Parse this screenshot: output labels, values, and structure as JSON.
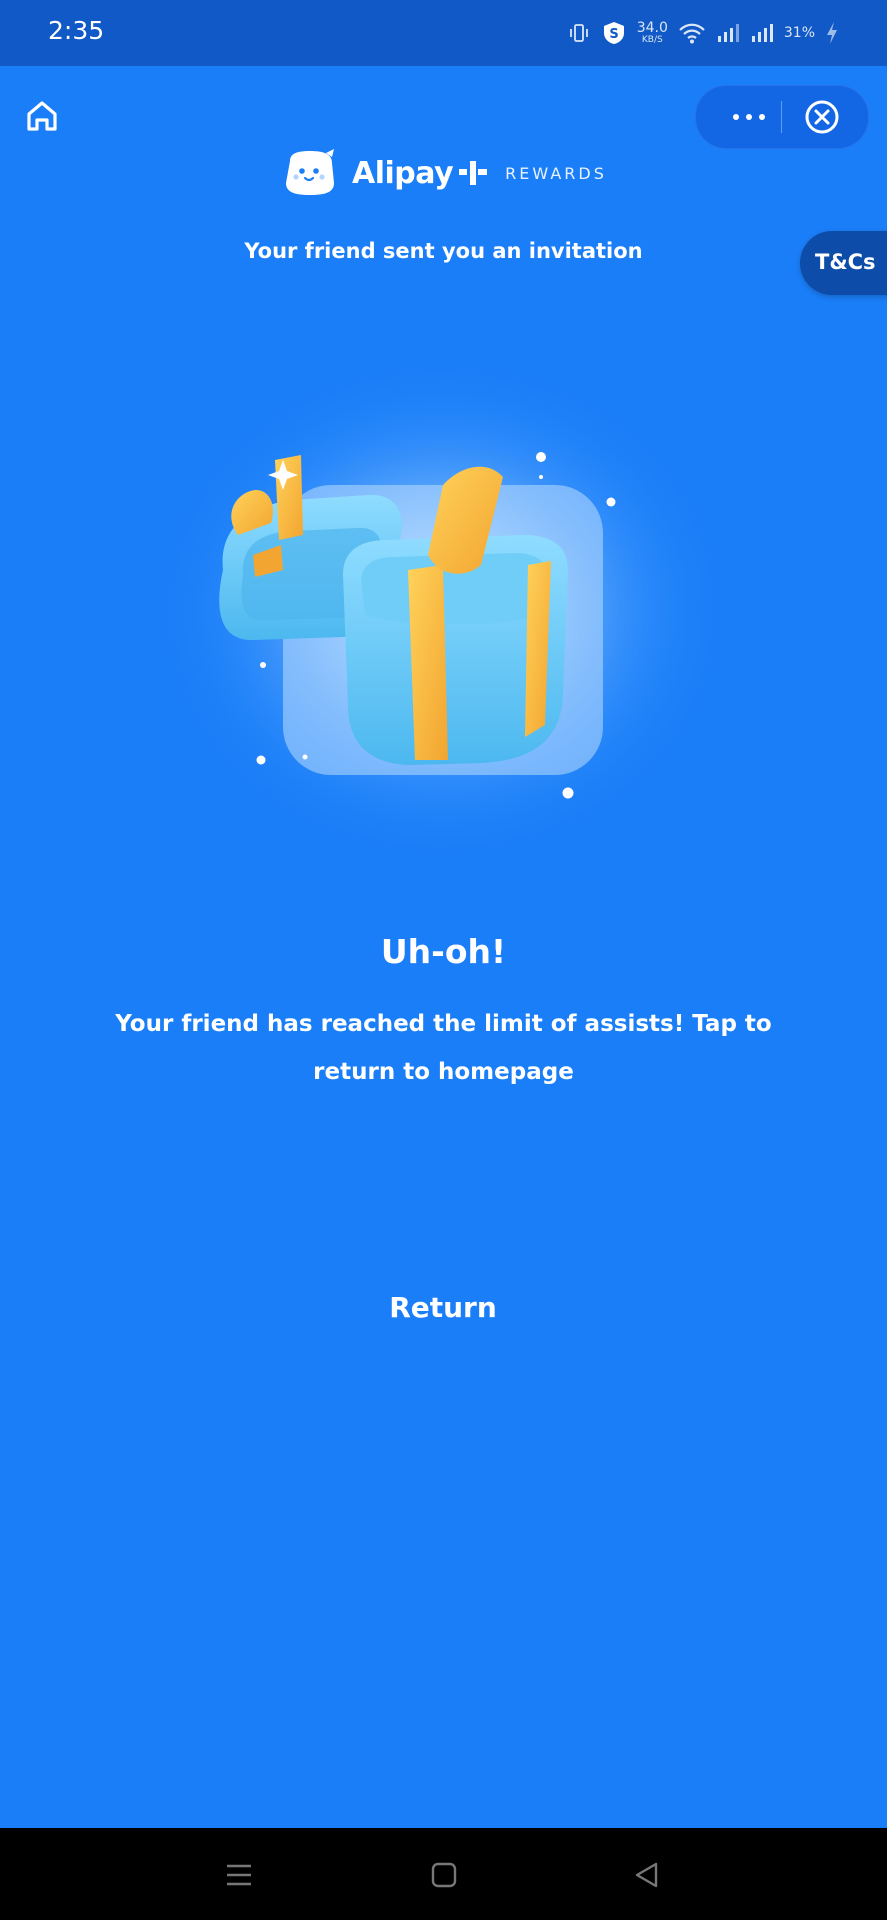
{
  "status_bar": {
    "time": "2:35",
    "net_speed_value": "34.0",
    "net_speed_unit": "KB/S",
    "battery": "31%",
    "icons": [
      "vibrate-icon",
      "shield-s-icon",
      "wifi-icon",
      "signal-icon",
      "signal-icon",
      "charging-icon"
    ]
  },
  "header": {
    "home_icon": "home-icon",
    "more_icon": "more-dots-icon",
    "close_icon": "close-circle-icon"
  },
  "brand": {
    "name": "Alipay",
    "tagline": "REWARDS",
    "mascot_icon": "alipay-mascot-icon",
    "plus_icon": "alipay-plus-icon"
  },
  "invite_text": "Your friend sent you an invitation",
  "tcs_label": "T&Cs",
  "message": {
    "title": "Uh-oh!",
    "body": "Your friend has reached the limit of assists! Tap to return to homepage"
  },
  "return_label": "Return",
  "nav_bar": {
    "menu_icon": "menu-icon",
    "home_icon": "square-home-icon",
    "back_icon": "triangle-back-icon"
  },
  "colors": {
    "background": "#1a7ef8",
    "status_bar": "#1159c6",
    "tab_bg": "#0d4ca9",
    "gift_box": "#62c6f3",
    "ribbon": "#f7b33e"
  }
}
